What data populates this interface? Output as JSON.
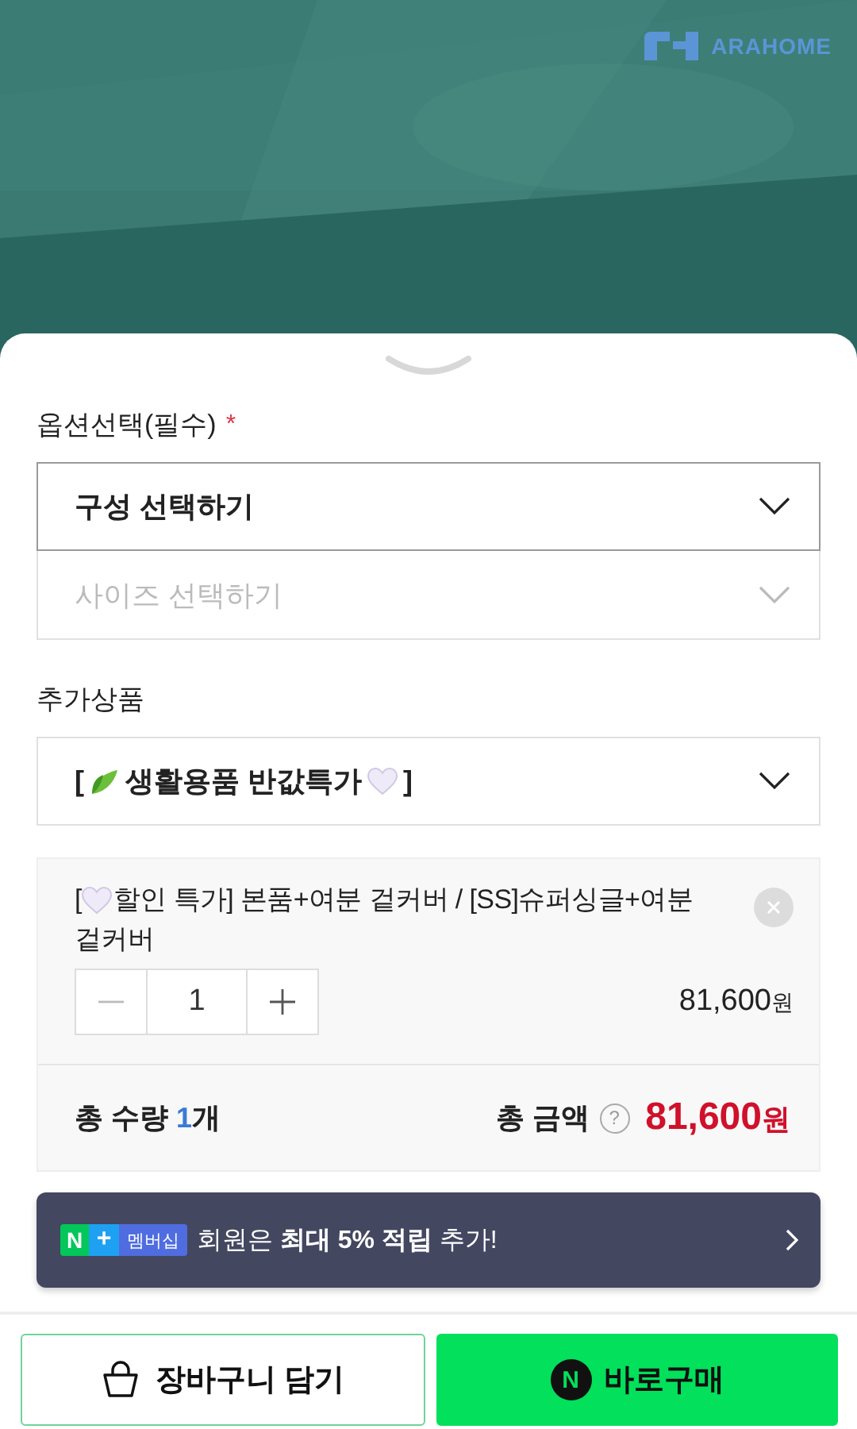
{
  "brand": {
    "name": "ARAHOME"
  },
  "options": {
    "label": "옵션선택(필수)",
    "required_mark": "*",
    "selects": [
      {
        "text": "구성 선택하기",
        "disabled": false
      },
      {
        "text": "사이즈 선택하기",
        "disabled": true
      }
    ]
  },
  "addons": {
    "label": "추가상품",
    "select": {
      "prefix": "[",
      "text": "생활용품 반값특가",
      "suffix": "]",
      "disabled": false
    }
  },
  "cart_item": {
    "name_prefix": "[",
    "name_lines": [
      "할인 특가] 본품+여분 겉커버 / [SS]슈퍼싱글+여분",
      "겉커버"
    ],
    "quantity": "1",
    "minus_disabled": true,
    "price": "81,600",
    "price_unit": "원"
  },
  "totals": {
    "quantity_label": "총 수량",
    "quantity": "1",
    "quantity_unit": "개",
    "amount_label": "총 금액",
    "help": "?",
    "amount": "81,600",
    "amount_unit": "원"
  },
  "banner": {
    "badge_letter": "N",
    "badge_plus": "+",
    "badge_label": "멤버십",
    "text": "회원은 **최대 5% 적립** 추가!"
  },
  "buttons": {
    "cart": "장바구니 담기",
    "buy_badge": "N",
    "buy": "바로구매"
  }
}
